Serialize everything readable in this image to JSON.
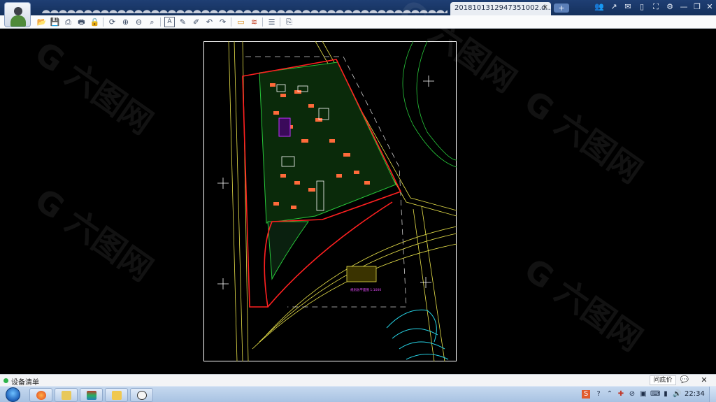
{
  "app": {
    "document_tab": "20181013129473510​02.d...",
    "new_tab_symbol": "+"
  },
  "toolbar": {
    "icons": [
      "open-icon",
      "save-icon",
      "print-icon",
      "print-preview-icon",
      "lock-icon",
      "rotate-icon",
      "zoom-in-icon",
      "zoom-out-icon",
      "zoom-window-icon",
      "text-icon",
      "pen-icon",
      "eraser-icon",
      "undo-icon",
      "redo-icon",
      "layer-icon",
      "measure-icon",
      "stack-icon",
      "export-icon"
    ]
  },
  "drawing": {
    "legend_label": "规划总平面图 1:1000",
    "colors": {
      "boundary": "#ff2020",
      "roads": "#e9e24a",
      "landscape": "#27c93a",
      "buildings": "#ff6a3a",
      "frame": "#ffffff",
      "cyan_buildings": "#27d6e8",
      "magenta": "#c030ff"
    }
  },
  "status": {
    "label": "设备清单",
    "ask_price": "问底价",
    "chat_symbol": "💬",
    "close_symbol": "✕"
  },
  "taskbar": {
    "clock": "22:34"
  },
  "watermark": {
    "text": "G 六图网"
  }
}
